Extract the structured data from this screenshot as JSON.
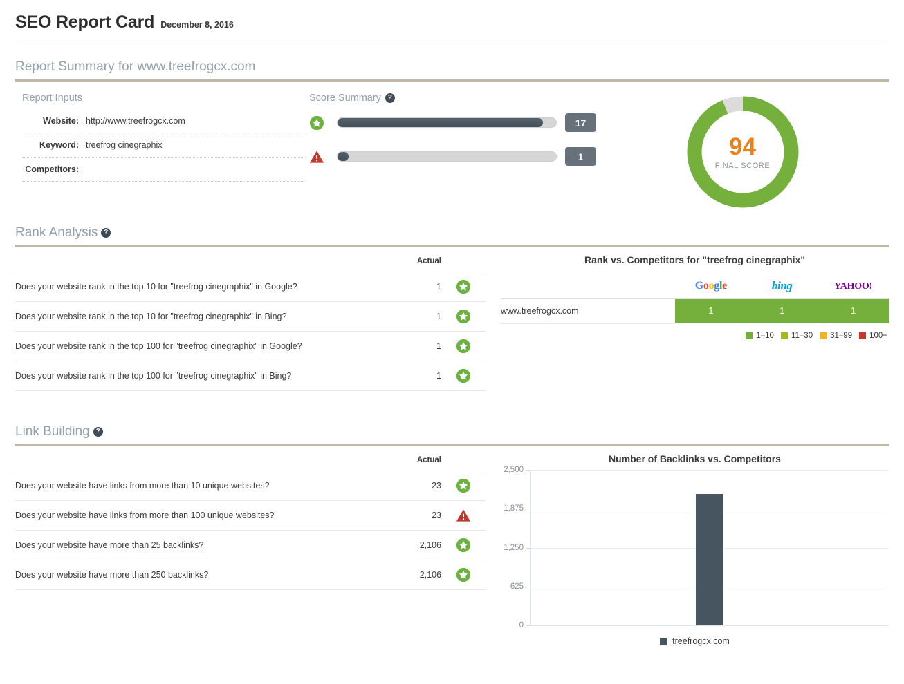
{
  "header": {
    "title": "SEO Report Card",
    "date": "December 8, 2016"
  },
  "summary_section": {
    "heading": "Report Summary for www.treefrogcx.com",
    "inputs": {
      "title": "Report Inputs",
      "rows": [
        {
          "label": "Website:",
          "value": "http://www.treefrogcx.com"
        },
        {
          "label": "Keyword:",
          "value": "treefrog cinegraphix"
        },
        {
          "label": "Competitors:",
          "value": ""
        }
      ]
    },
    "score_summary": {
      "title": "Score Summary",
      "help": "?",
      "bars": [
        {
          "icon": "green-star-icon",
          "value": "17",
          "fill_percent": 94
        },
        {
          "icon": "red-warning-icon",
          "value": "1",
          "fill_percent": 5
        }
      ]
    },
    "final_score": {
      "value": "94",
      "label": "FINAL SCORE",
      "percent": 94,
      "ring_color": "#76b03c",
      "track_color": "#dcdcdc",
      "value_color": "#e8821a"
    }
  },
  "rank_analysis": {
    "heading": "Rank Analysis",
    "help": "?",
    "columns": {
      "question": "",
      "actual": "Actual"
    },
    "rows": [
      {
        "question": "Does your website rank in the top 10 for \"treefrog cinegraphix\" in Google?",
        "actual": "1",
        "status": "pass"
      },
      {
        "question": "Does your website rank in the top 10 for \"treefrog cinegraphix\" in Bing?",
        "actual": "1",
        "status": "pass"
      },
      {
        "question": "Does your website rank in the top 100 for \"treefrog cinegraphix\" in Google?",
        "actual": "1",
        "status": "pass"
      },
      {
        "question": "Does your website rank in the top 100 for \"treefrog cinegraphix\" in Bing?",
        "actual": "1",
        "status": "pass"
      }
    ],
    "competitors_panel": {
      "title": "Rank vs. Competitors for \"treefrog cinegraphix\"",
      "engines": [
        "Google",
        "bing",
        "YAHOO!"
      ],
      "rows": [
        {
          "site": "www.treefrogcx.com",
          "values": [
            "1",
            "1",
            "1"
          ],
          "band_color": "#76b03c"
        }
      ],
      "legend": [
        {
          "label": "1–10",
          "color": "#76b03c"
        },
        {
          "label": "11–30",
          "color": "#a8b820"
        },
        {
          "label": "31–99",
          "color": "#f0b422"
        },
        {
          "label": "100+",
          "color": "#c1392b"
        }
      ]
    }
  },
  "link_building": {
    "heading": "Link Building",
    "help": "?",
    "columns": {
      "question": "",
      "actual": "Actual"
    },
    "rows": [
      {
        "question": "Does your website have links from more than 10 unique websites?",
        "actual": "23",
        "status": "pass"
      },
      {
        "question": "Does your website have links from more than 100 unique websites?",
        "actual": "23",
        "status": "fail"
      },
      {
        "question": "Does your website have more than 25 backlinks?",
        "actual": "2,106",
        "status": "pass"
      },
      {
        "question": "Does your website have more than 250 backlinks?",
        "actual": "2,106",
        "status": "pass"
      }
    ],
    "chart_data": {
      "type": "bar",
      "title": "Number of Backlinks vs. Competitors",
      "categories": [
        "treefrogcx.com"
      ],
      "values": [
        2106
      ],
      "series": [
        {
          "name": "treefrogcx.com",
          "values": [
            2106
          ],
          "color": "#475561"
        }
      ],
      "xlabel": "",
      "ylabel": "",
      "ylim": [
        0,
        2500
      ],
      "yticks": [
        0,
        625,
        1250,
        1875,
        2500
      ],
      "ytick_labels": [
        "0",
        "625",
        "1,250",
        "1,875",
        "2,500"
      ],
      "grid": true,
      "legend_position": "bottom"
    }
  },
  "icons": {
    "pass": "green-star-icon",
    "fail": "red-warning-icon",
    "help": "question-mark-icon"
  }
}
